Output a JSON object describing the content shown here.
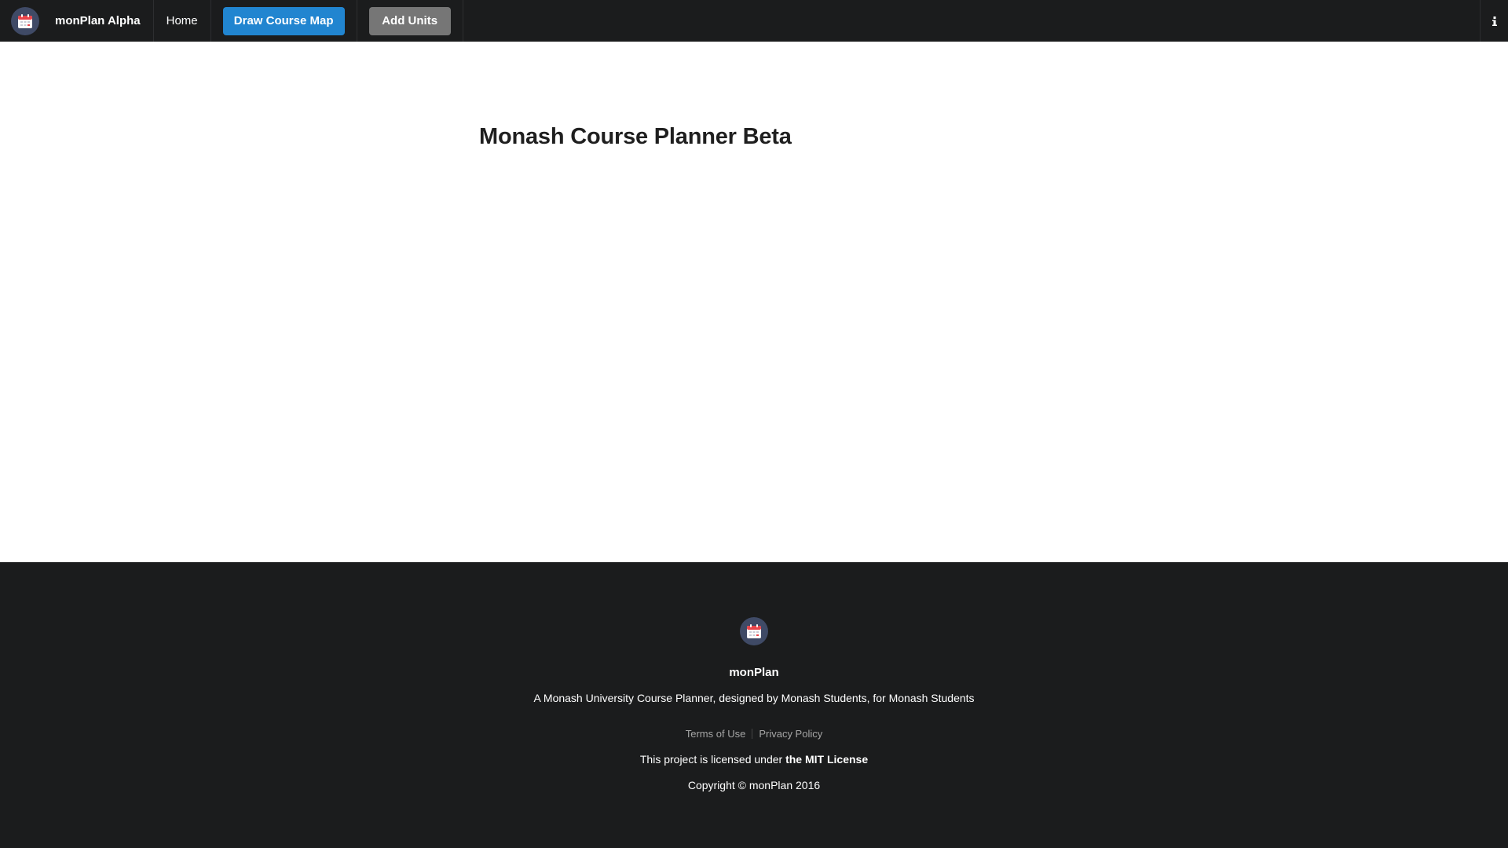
{
  "navbar": {
    "brand": "monPlan Alpha",
    "home_label": "Home",
    "draw_button_label": "Draw Course Map",
    "add_units_label": "Add Units",
    "info_icon": "info-icon"
  },
  "main": {
    "title": "Monash Course Planner Beta"
  },
  "footer": {
    "name": "monPlan",
    "description": "A Monash University Course Planner, designed by Monash Students, for Monash Students",
    "links": [
      "Terms of Use",
      "Privacy Policy"
    ],
    "license_prefix": "This project is licensed under ",
    "license_link": "the MIT License",
    "copyright": "Copyright © monPlan 2016"
  },
  "colors": {
    "navbar_bg": "#1b1c1d",
    "primary_button": "#2185d0",
    "secondary_button": "#767676",
    "logo_bg": "#3f4a66",
    "calendar_red": "#e8454b"
  }
}
